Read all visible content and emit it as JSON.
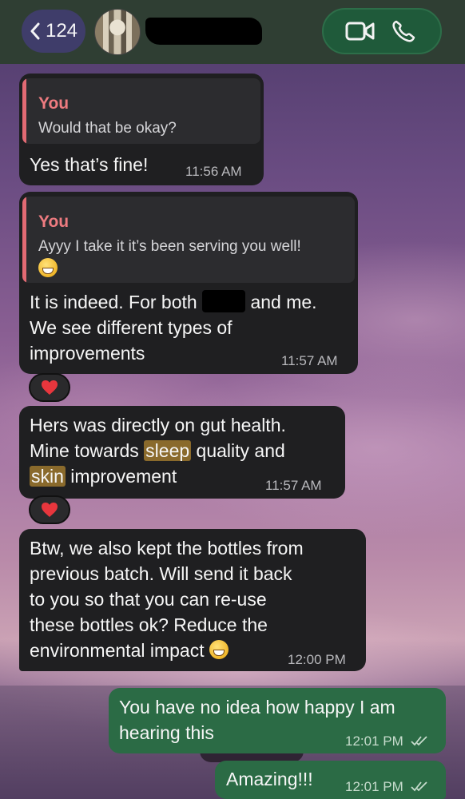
{
  "header": {
    "back_count": "124",
    "contact_name": ""
  },
  "messages": [
    {
      "quote_author": "You",
      "quote_text": "Would that be okay?",
      "text": "Yes that’s fine!",
      "time": "11:56 AM"
    },
    {
      "quote_author": "You",
      "quote_text": "Ayyy I take it it’s been serving you well!",
      "text_line1_a": "It is indeed. For both",
      "text_line1_b": "and me.",
      "text_line2": "We see different types of",
      "text_line3": "improvements",
      "time": "11:57 AM",
      "reaction": "red-heart"
    },
    {
      "line1": "Hers was directly on gut health.",
      "line2_a": "Mine towards",
      "line2_hl": "sleep",
      "line2_b": "quality and",
      "line3_hl": "skin",
      "line3_b": "improvement",
      "time": "11:57 AM",
      "reaction": "red-heart"
    },
    {
      "line1": "Btw, we also kept the bottles from",
      "line2": "previous batch. Will send it back",
      "line3": "to you so that you can re-use",
      "line4": "these bottles ok? Reduce the",
      "line5": "environmental impact",
      "time": "12:00 PM"
    },
    {
      "line1": "You have no idea how happy I am",
      "line2": "hearing this",
      "time": "12:01 PM",
      "status": "read"
    },
    {
      "text": "Amazing!!!",
      "time": "12:01 PM",
      "status": "read"
    }
  ],
  "icons": {
    "back": "chevron-left-icon",
    "video": "video-camera-icon",
    "phone": "phone-icon",
    "reaction": "heart-icon",
    "read": "double-check-icon",
    "emoji": "grinning-face-icon"
  },
  "colors": {
    "incoming_bubble": "#1f1f21",
    "outgoing_bubble": "#2b6b45",
    "quote_author": "#ee7b80",
    "highlight": "#8a6a2c",
    "header": "#2f3e33"
  }
}
